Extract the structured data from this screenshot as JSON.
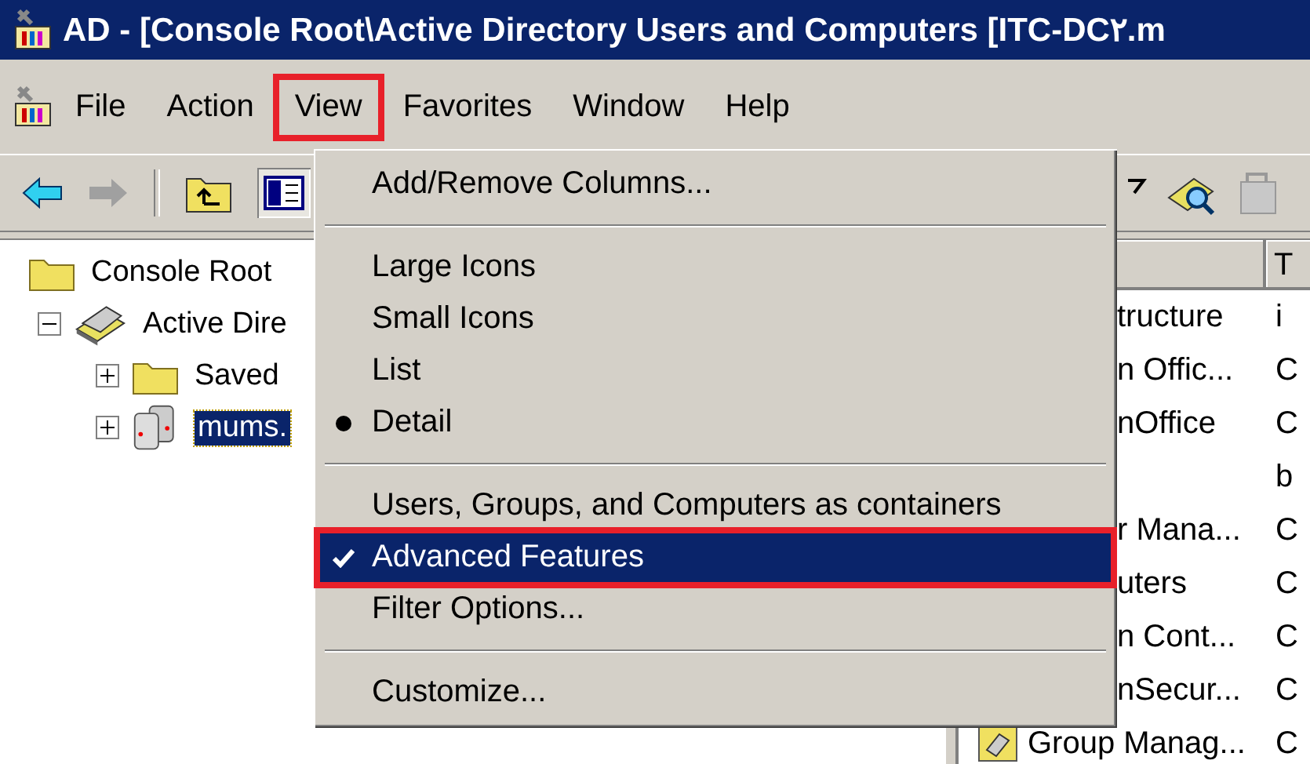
{
  "window": {
    "title": "AD - [Console Root\\Active Directory Users and Computers [ITC-DC۲.m"
  },
  "menubar": [
    {
      "label": "File",
      "selected": false,
      "annotated": false
    },
    {
      "label": "Action",
      "selected": false,
      "annotated": false
    },
    {
      "label": "View",
      "selected": true,
      "annotated": true
    },
    {
      "label": "Favorites",
      "selected": false,
      "annotated": false
    },
    {
      "label": "Window",
      "selected": false,
      "annotated": false
    },
    {
      "label": "Help",
      "selected": false,
      "annotated": false
    }
  ],
  "tree": [
    {
      "label": "Console Root",
      "kind": "folder",
      "selected": false,
      "children": [
        {
          "label": "Active Dire",
          "kind": "directory",
          "expanded": true,
          "selected": false,
          "children": [
            {
              "label": "Saved",
              "kind": "folder",
              "expanded": false,
              "selected": false
            },
            {
              "label": "mums.",
              "kind": "servers",
              "expanded": false,
              "selected": true
            }
          ]
        }
      ]
    }
  ],
  "list": {
    "column_2": "T",
    "rows": [
      {
        "column_1": "tructure",
        "column_2": "i"
      },
      {
        "column_1": "n Offic...",
        "column_2": "C"
      },
      {
        "column_1": "nOffice",
        "column_2": "C"
      },
      {
        "column_2": "b"
      },
      {
        "column_1": "r Mana...",
        "column_2": "C"
      },
      {
        "column_1": "uters",
        "column_2": "C"
      },
      {
        "column_1": "n Cont...",
        "column_2": "C"
      },
      {
        "column_1": "nSecur...",
        "column_2": "C"
      },
      {
        "column_1": "Group Manag...",
        "column_2": "C"
      }
    ]
  },
  "view_menu": {
    "items": [
      {
        "kind": "item",
        "label": "Add/Remove Columns...",
        "checked": false,
        "selected": false,
        "annotated": false
      },
      {
        "kind": "separator"
      },
      {
        "kind": "radio",
        "label": "Large Icons",
        "checked": false,
        "selected": false,
        "annotated": false
      },
      {
        "kind": "radio",
        "label": "Small Icons",
        "checked": false,
        "selected": false,
        "annotated": false
      },
      {
        "kind": "radio",
        "label": "List",
        "checked": false,
        "selected": false,
        "annotated": false
      },
      {
        "kind": "radio",
        "label": "Detail",
        "checked": true,
        "selected": false,
        "annotated": false
      },
      {
        "kind": "separator"
      },
      {
        "kind": "item",
        "label": "Users, Groups, and Computers as containers",
        "checked": false,
        "selected": false,
        "annotated": false
      },
      {
        "kind": "item",
        "label": "Advanced Features",
        "checked": true,
        "selected": true,
        "annotated": true
      },
      {
        "kind": "item",
        "label": "Filter Options...",
        "checked": false,
        "selected": false,
        "annotated": false
      },
      {
        "kind": "separator"
      },
      {
        "kind": "item",
        "label": "Customize...",
        "checked": false,
        "selected": false,
        "annotated": false
      }
    ]
  }
}
